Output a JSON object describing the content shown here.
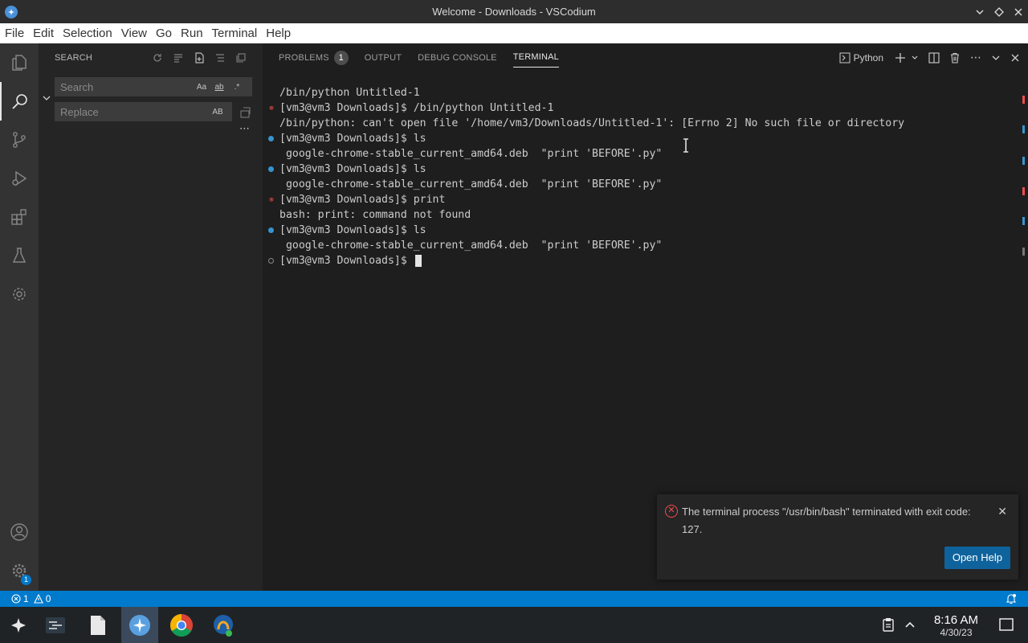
{
  "window": {
    "title": "Welcome - Downloads - VSCodium"
  },
  "menu": [
    "File",
    "Edit",
    "Selection",
    "View",
    "Go",
    "Run",
    "Terminal",
    "Help"
  ],
  "sidebar": {
    "header": "SEARCH",
    "search_placeholder": "Search",
    "replace_placeholder": "Replace",
    "search_options": [
      "Aa",
      "ab",
      ".*"
    ],
    "replace_options": [
      "AB"
    ]
  },
  "panel": {
    "tabs": [
      {
        "label": "PROBLEMS",
        "badge": "1"
      },
      {
        "label": "OUTPUT"
      },
      {
        "label": "DEBUG CONSOLE"
      },
      {
        "label": "TERMINAL"
      }
    ],
    "active_tab": "TERMINAL",
    "terminal_profile": "Python"
  },
  "terminal": {
    "lines": [
      {
        "text": "/bin/python Untitled-1",
        "deco": "none"
      },
      {
        "text": "[vm3@vm3 Downloads]$ /bin/python Untitled-1",
        "deco": "error"
      },
      {
        "text": "/bin/python: can't open file '/home/vm3/Downloads/Untitled-1': [Errno 2] No such file or directory",
        "deco": "none"
      },
      {
        "text": "[vm3@vm3 Downloads]$ ls",
        "deco": "success"
      },
      {
        "text": " google-chrome-stable_current_amd64.deb  \"print 'BEFORE'.py\"",
        "deco": "none"
      },
      {
        "text": "[vm3@vm3 Downloads]$ ls",
        "deco": "success"
      },
      {
        "text": " google-chrome-stable_current_amd64.deb  \"print 'BEFORE'.py\"",
        "deco": "none"
      },
      {
        "text": "[vm3@vm3 Downloads]$ print",
        "deco": "error"
      },
      {
        "text": "bash: print: command not found",
        "deco": "none"
      },
      {
        "text": "[vm3@vm3 Downloads]$ ls",
        "deco": "success"
      },
      {
        "text": " google-chrome-stable_current_amd64.deb  \"print 'BEFORE'.py\"",
        "deco": "none"
      },
      {
        "text": "[vm3@vm3 Downloads]$ ",
        "deco": "pending",
        "cursor": true
      }
    ]
  },
  "notification": {
    "message": "The terminal process \"/usr/bin/bash\" terminated with exit code: 127.",
    "button": "Open Help"
  },
  "statusbar": {
    "errors": "1",
    "warnings": "0"
  },
  "taskbar": {
    "time": "8:16 AM",
    "date": "4/30/23"
  },
  "accounts_badge": "1",
  "colors": {
    "accent": "#007acc",
    "error": "#f14c4c",
    "success": "#3794d1"
  }
}
